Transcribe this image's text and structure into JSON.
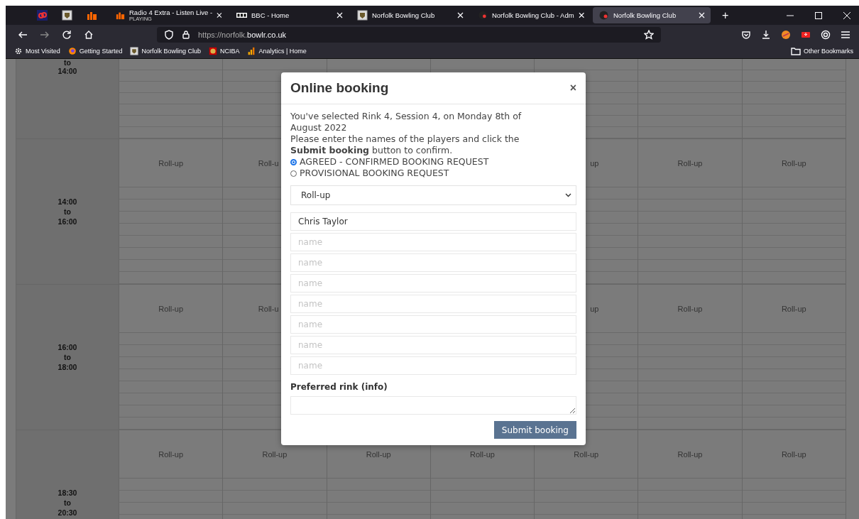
{
  "browser": {
    "pinned_tabs": [
      {
        "kind": "red"
      },
      {
        "kind": "crest"
      },
      {
        "kind": "radio"
      }
    ],
    "tabs": [
      {
        "title": "Radio 4 Extra - Listen Live -",
        "subtitle": "PLAYING",
        "selected": false
      },
      {
        "title": "BBC - Home",
        "selected": false
      },
      {
        "title": "Norfolk Bowling Club",
        "selected": false
      },
      {
        "title": "Norfolk Bowling Club - Adm",
        "selected": false
      },
      {
        "title": "Norfolk Bowling Club",
        "selected": true
      }
    ],
    "new_tab": "+",
    "url": {
      "prefix": "https://norfolk.",
      "domain": "bowlr.co.uk"
    },
    "bookmarks": [
      {
        "label": "Most Visited"
      },
      {
        "label": "Getting Started"
      },
      {
        "label": "Norfolk Bowling Club"
      },
      {
        "label": "NCIBA"
      },
      {
        "label": "Analytics | Home"
      }
    ],
    "other_bookmarks": "Other Bookmarks"
  },
  "timetable": {
    "blocks": [
      {
        "time": [
          "to",
          "14:00"
        ]
      },
      {
        "time": [
          "14:00",
          "to",
          "16:00"
        ],
        "cells": [
          "Roll-up",
          "Roll-u",
          "up",
          "Roll-up",
          "Roll-up"
        ]
      },
      {
        "time": [
          "16:00",
          "to",
          "18:00"
        ],
        "cells": [
          "Roll-up",
          "Roll-u",
          "up",
          "Roll-up",
          "Roll-up"
        ]
      },
      {
        "time": [
          "18:30",
          "to",
          "20:30"
        ],
        "cells": [
          "Roll-up",
          "Roll-up",
          "Roll-up",
          "Roll-up",
          "Roll-up",
          "Roll-up",
          "Roll-up"
        ]
      }
    ]
  },
  "modal": {
    "title": "Online booking",
    "close": "×",
    "message": "You've selected Rink 4, Session 4, on Monday 8th of August 2022",
    "instruction": "Please enter the names of the players and click the **Submit booking** button to confirm.",
    "radios": [
      {
        "label": "AGREED - CONFIRMED BOOKING REQUEST",
        "selected": true
      },
      {
        "label": "PROVISIONAL BOOKING REQUEST",
        "selected": false
      }
    ],
    "select": {
      "value": "Roll-up"
    },
    "players": [
      {
        "value": "Chris Taylor"
      },
      {
        "placeholder": "name"
      },
      {
        "placeholder": "name"
      },
      {
        "placeholder": "name"
      },
      {
        "placeholder": "name"
      },
      {
        "placeholder": "name"
      },
      {
        "placeholder": "name"
      },
      {
        "placeholder": "name"
      }
    ],
    "rink_label": "Preferred rink (info)",
    "submit": "Submit booking"
  }
}
